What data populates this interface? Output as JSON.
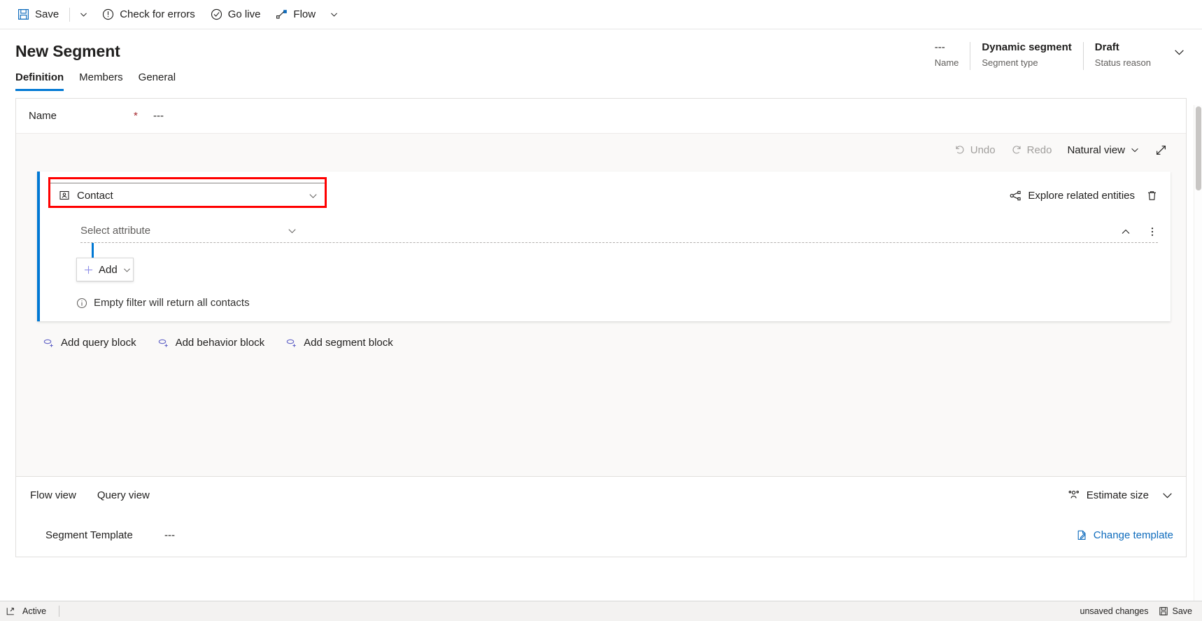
{
  "commandbar": {
    "items": [
      {
        "label": "Save",
        "icon": "save-icon"
      },
      {
        "label": "Check for errors",
        "icon": "error-circle-icon"
      },
      {
        "label": "Go live",
        "icon": "check-circle-icon"
      },
      {
        "label": "Flow",
        "icon": "flow-icon"
      }
    ]
  },
  "header": {
    "title": "New Segment",
    "fields": [
      {
        "value": "---",
        "label": "Name",
        "bold": false
      },
      {
        "value": "Dynamic segment",
        "label": "Segment type",
        "bold": true
      },
      {
        "value": "Draft",
        "label": "Status reason",
        "bold": true
      }
    ]
  },
  "tabs": [
    {
      "label": "Definition",
      "active": true
    },
    {
      "label": "Members",
      "active": false
    },
    {
      "label": "General",
      "active": false
    }
  ],
  "name_row": {
    "label": "Name",
    "required_marker": "*",
    "value": "---"
  },
  "canvas_toolbar": {
    "undo_label": "Undo",
    "redo_label": "Redo",
    "view_label": "Natural view",
    "expand_icon": "expand-diagonal-icon"
  },
  "block": {
    "entity": {
      "value": "Contact",
      "icon": "contact-entity-icon",
      "highlighted": true,
      "highlight_color": "#ff0000"
    },
    "explore_label": "Explore related entities",
    "delete_icon": "trash-icon",
    "attribute": {
      "placeholder": "Select attribute"
    },
    "add_label": "Add",
    "empty_note": "Empty filter will return all contacts"
  },
  "block_actions": [
    {
      "label": "Add query block",
      "icon": "add-block-icon"
    },
    {
      "label": "Add behavior block",
      "icon": "add-block-icon"
    },
    {
      "label": "Add segment block",
      "icon": "add-block-icon"
    }
  ],
  "footer": {
    "view_tabs": [
      {
        "label": "Flow view"
      },
      {
        "label": "Query view"
      }
    ],
    "estimate_label": "Estimate size",
    "estimate_icon": "people-icon",
    "template_label": "Segment Template",
    "template_value": "---",
    "change_template_label": "Change template",
    "change_template_icon": "edit-page-icon"
  },
  "statusbar": {
    "state": "Active",
    "unsaved": "unsaved changes",
    "save_label": "Save",
    "left_icon": "popout-icon",
    "save_icon": "save-icon"
  },
  "colors": {
    "accent": "#0078d4",
    "link": "#0f6cbd",
    "highlight": "#ff0000",
    "required": "#a4262c",
    "canvas_bg": "#faf9f8"
  }
}
